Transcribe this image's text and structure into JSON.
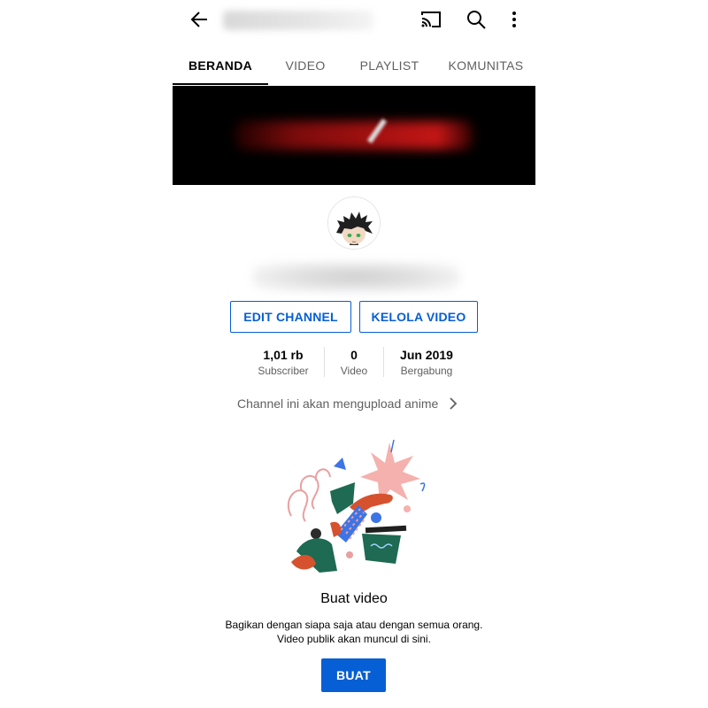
{
  "tabs": [
    {
      "label": "BERANDA",
      "active": true
    },
    {
      "label": "VIDEO",
      "active": false
    },
    {
      "label": "PLAYLIST",
      "active": false
    },
    {
      "label": "KOMUNITAS",
      "active": false
    }
  ],
  "actions": {
    "edit_channel": "EDIT CHANNEL",
    "manage_videos": "KELOLA VIDEO"
  },
  "stats": [
    {
      "value": "1,01 rb",
      "label": "Subscriber"
    },
    {
      "value": "0",
      "label": "Video"
    },
    {
      "value": "Jun 2019",
      "label": "Bergabung"
    }
  ],
  "description": "Channel ini akan mengupload anime",
  "empty_state": {
    "title": "Buat video",
    "line1": "Bagikan dengan siapa saja atau dengan semua orang.",
    "line2": "Video publik akan muncul di sini.",
    "button": "BUAT"
  },
  "icons": {
    "back": "arrow-left-icon",
    "cast": "cast-icon",
    "search": "search-icon",
    "more": "more-vert-icon",
    "chevron": "chevron-right-icon"
  },
  "colors": {
    "accent": "#065fd4",
    "text_primary": "#030303",
    "text_secondary": "#606060"
  }
}
